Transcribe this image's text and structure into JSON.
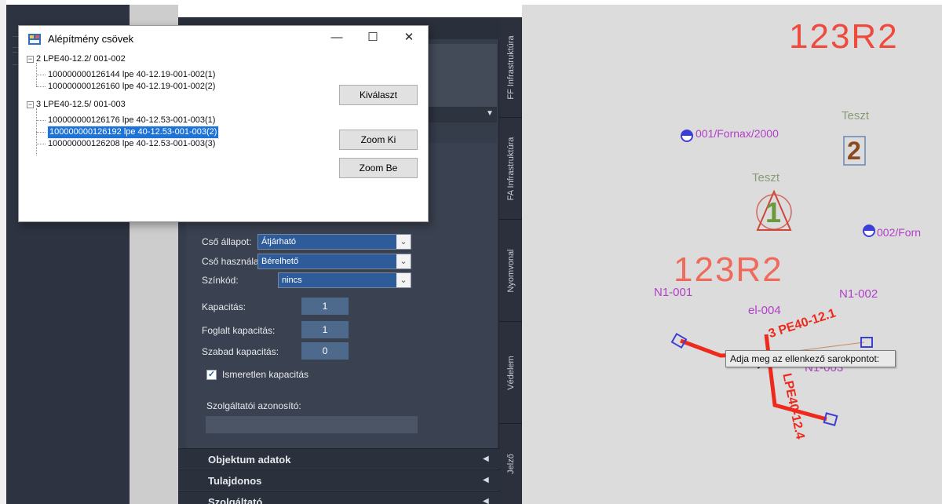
{
  "dialog": {
    "title": "Alépítmény csövek",
    "controls": {
      "minimize": "—",
      "maximize": "☐",
      "close": "✕"
    },
    "tree": [
      {
        "label": "2 LPE40-12.2/ 001-002",
        "children": [
          "100000000126144 lpe 40-12.19-001-002(1)",
          "100000000126160 lpe 40-12.19-001-002(2)"
        ]
      },
      {
        "label": "3 LPE40-12.5/ 001-003",
        "children": [
          "100000000126176 lpe 40-12.53-001-003(1)",
          "100000000126192 lpe 40-12.53-001-003(2)",
          "100000000126208 lpe 40-12.53-001-003(3)"
        ]
      }
    ],
    "selected_item": "100000000126192 lpe 40-12.53-001-003(2)",
    "buttons": {
      "select": "Kiválaszt",
      "zoom_out": "Zoom Ki",
      "zoom_in": "Zoom Be"
    }
  },
  "panel": {
    "fields": {
      "pipe_state_label": "Cső állapot:",
      "pipe_state_value": "Átjárható",
      "pipe_usage_label": "Cső használat:",
      "pipe_usage_value": "Bérelhető",
      "color_code_label": "Színkód:",
      "color_code_value": "nincs",
      "capacity_label": "Kapacitás:",
      "capacity_value": "1",
      "occupied_label": "Foglalt kapacitás:",
      "occupied_value": "1",
      "free_label": "Szabad kapacitás:",
      "free_value": "0",
      "unknown_capacity_label": "Ismeretlen kapacitás",
      "unknown_capacity_checked": true,
      "provider_id_label": "Szolgáltatói azonosító:",
      "provider_id_value": ""
    },
    "sections": [
      "Objektum adatok",
      "Tulajdonos",
      "Szolgáltató"
    ]
  },
  "side_tabs": [
    "FF Infrastruktúra",
    "FA Infrastruktúra",
    "Nyomvonal",
    "Védelem",
    "Jelző"
  ],
  "cad": {
    "big_label_top": "123R2",
    "big_label_mid": "123R2",
    "node_1": "001/Fornax/2000",
    "node_2": "002/Forn",
    "test_label_1": "Teszt",
    "test_label_2": "Teszt",
    "marker_number_1": "2",
    "marker_number_2": "1",
    "n1_001": "N1-001",
    "n1_002": "N1-002",
    "n1_003": "N1-003",
    "el_004": "el-004",
    "pipe_label_1": "3 PE40-12.1",
    "pipe_label_2": "LPE40-12.4",
    "tooltip": "Adja meg az ellenkező sarokpontot:"
  },
  "colors": {
    "accent_red": "#e8463a",
    "magenta": "#b23fc8",
    "selection_blue": "#1e73d6",
    "panel_dark": "#353c4a"
  }
}
